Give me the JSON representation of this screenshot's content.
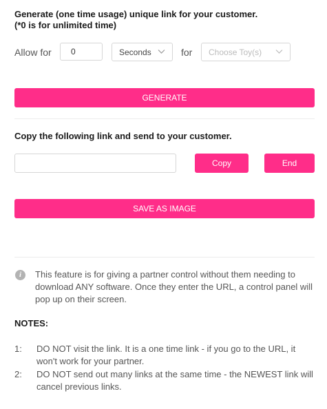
{
  "heading": {
    "line1": "Generate (one time usage) unique link for your customer.",
    "line2": "(*0 is for unlimited time)"
  },
  "allow": {
    "label": "Allow for",
    "value": "0",
    "unit_selected": "Seconds",
    "for_label": "for",
    "toy_placeholder": "Choose Toy(s)"
  },
  "buttons": {
    "generate": "GENERATE",
    "copy": "Copy",
    "end": "End",
    "save_as_image": "SAVE AS IMAGE"
  },
  "link_section": {
    "title": "Copy the following link and send to your customer.",
    "link_value": ""
  },
  "info": {
    "text": "This feature is for giving a partner control without them needing to download ANY software. Once they enter the URL, a control panel will pop up on their screen."
  },
  "notes": {
    "title": "NOTES:",
    "items": [
      {
        "num": "1:",
        "text": "DO NOT visit the link. It is a one time link - if you go to the URL, it won't work for your partner."
      },
      {
        "num": "2:",
        "text": "DO NOT send out many links at the same time - the NEWEST link will cancel previous links."
      }
    ]
  },
  "colors": {
    "accent": "#ff2d89",
    "placeholder": "#bbbbbb",
    "info_icon": "#b3b3b3"
  },
  "icons": {
    "select_arrow": "chevron-down-icon",
    "info": "info-icon"
  }
}
